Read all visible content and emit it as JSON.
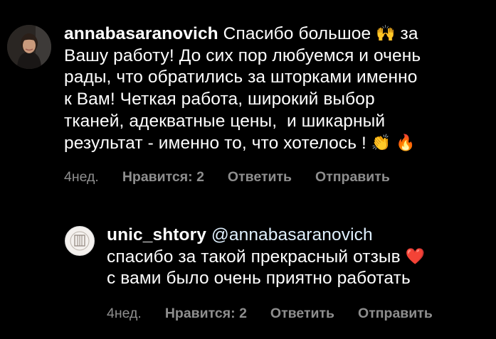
{
  "comments": [
    {
      "username": "annabasaranovich",
      "text_parts": [
        " Спасибо большое ",
        " за\nВашу работу! До сих пор любуемся и очень\nрады, что обратились за шторками именно\nк Вам! Четкая работа, широкий выбор\nтканей, адекватные цены,  и шикарный\nрезультат - именно то, что хотелось ! "
      ],
      "emojis": [
        "🙌",
        "👏",
        "🔥"
      ],
      "time": "4нед.",
      "likes": "Нравится: 2",
      "reply": "Ответить",
      "send": "Отправить",
      "avatar_icon": "woman-avatar"
    },
    {
      "username": "unic_shtory",
      "mention": "@annabasaranovich",
      "text_parts": [
        "\nспасибо за такой прекрасный отзыв ",
        "\nс вами было очень приятно работать"
      ],
      "emojis": [
        "❤️"
      ],
      "time": "4нед.",
      "likes": "Нравится: 2",
      "reply": "Ответить",
      "send": "Отправить",
      "avatar_icon": "brand-logo-avatar"
    }
  ],
  "colors": {
    "background": "#000000",
    "text": "#ffffff",
    "meta": "#8e8e8e",
    "mention": "#e0f1ff"
  }
}
